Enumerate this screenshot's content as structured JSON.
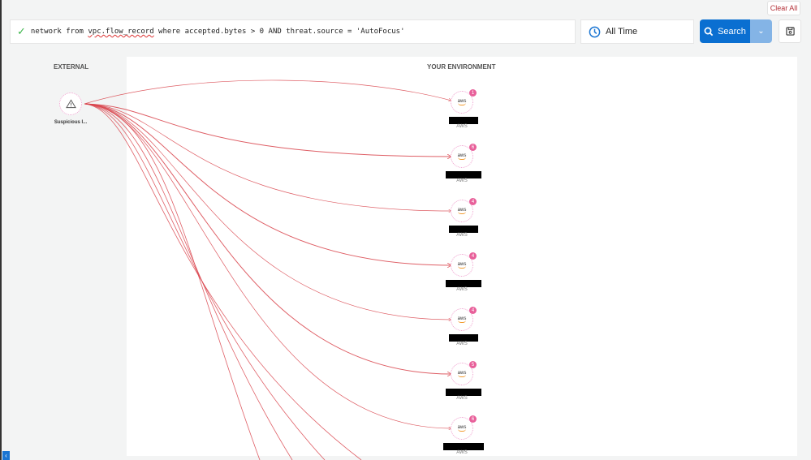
{
  "toolbar": {
    "clear_all": "Clear All",
    "query_pre": "network from ",
    "query_underlined": "vpc.flow_record",
    "query_post": " where accepted.bytes > 0 AND threat.source = 'AutoFocus'",
    "time_range": "All Time",
    "search_label": "Search"
  },
  "graph": {
    "external_header": "EXTERNAL",
    "environment_header": "YOUR ENVIRONMENT",
    "source": {
      "label": "Suspicious I...",
      "icon": "warning-icon"
    },
    "targets": [
      {
        "badge": "1",
        "provider": "AWS"
      },
      {
        "badge": "6",
        "provider": "AWS"
      },
      {
        "badge": "4",
        "provider": "AWS"
      },
      {
        "badge": "4",
        "provider": "AWS"
      },
      {
        "badge": "4",
        "provider": "AWS"
      },
      {
        "badge": "5",
        "provider": "AWS"
      },
      {
        "badge": "6",
        "provider": "AWS"
      }
    ],
    "node_logo": "aws",
    "colors": {
      "edge": "#d9434b",
      "badge": "#e8609a",
      "accent": "#0a6fd1"
    }
  }
}
